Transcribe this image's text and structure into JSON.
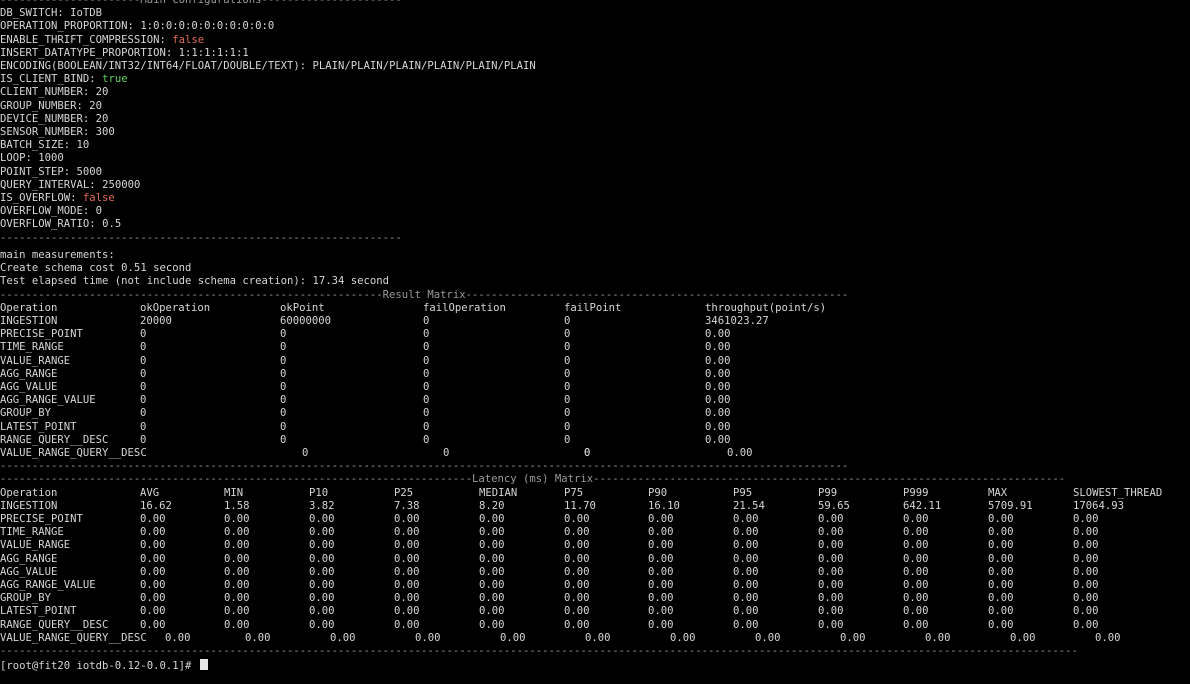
{
  "config": {
    "header": "----------------------Main Configurations----------------------",
    "items": [
      {
        "key": "DB_SWITCH: ",
        "value": "IoTDB",
        "color": "normal"
      },
      {
        "key": "OPERATION_PROPORTION: ",
        "value": "1:0:0:0:0:0:0:0:0:0:0",
        "color": "normal"
      },
      {
        "key": "ENABLE_THRIFT_COMPRESSION: ",
        "value": "false",
        "color": "red"
      },
      {
        "key": "INSERT_DATATYPE_PROPORTION: ",
        "value": "1:1:1:1:1:1",
        "color": "normal"
      },
      {
        "key": "ENCODING(BOOLEAN/INT32/INT64/FLOAT/DOUBLE/TEXT): ",
        "value": "PLAIN/PLAIN/PLAIN/PLAIN/PLAIN/PLAIN",
        "color": "normal"
      },
      {
        "key": "IS_CLIENT_BIND: ",
        "value": "true",
        "color": "green"
      },
      {
        "key": "CLIENT_NUMBER: ",
        "value": "20",
        "color": "normal"
      },
      {
        "key": "GROUP_NUMBER: ",
        "value": "20",
        "color": "normal"
      },
      {
        "key": "DEVICE_NUMBER: ",
        "value": "20",
        "color": "normal"
      },
      {
        "key": "SENSOR_NUMBER: ",
        "value": "300",
        "color": "normal"
      },
      {
        "key": "BATCH_SIZE: ",
        "value": "10",
        "color": "normal"
      },
      {
        "key": "LOOP: ",
        "value": "1000",
        "color": "normal"
      },
      {
        "key": "POINT_STEP: ",
        "value": "5000",
        "color": "normal"
      },
      {
        "key": "QUERY_INTERVAL: ",
        "value": "250000",
        "color": "normal"
      },
      {
        "key": "IS_OVERFLOW: ",
        "value": "false",
        "color": "red"
      },
      {
        "key": "OVERFLOW_MODE: ",
        "value": "0",
        "color": "normal"
      },
      {
        "key": "OVERFLOW_RATIO: ",
        "value": "0.5",
        "color": "normal"
      }
    ],
    "footer": "---------------------------------------------------------------"
  },
  "measurements": {
    "title": "main measurements:",
    "schema": "Create schema cost 0.51 second",
    "elapsed": "Test elapsed time (not include schema creation): 17.34 second"
  },
  "result_matrix": {
    "header": "------------------------------------------------------------Result Matrix------------------------------------------------------------",
    "columns": [
      "Operation",
      "okOperation",
      "okPoint",
      "failOperation",
      "failPoint",
      "throughput(point/s)"
    ],
    "rows": [
      [
        "INGESTION",
        "20000",
        "60000000",
        "0",
        "0",
        "3461023.27"
      ],
      [
        "PRECISE_POINT",
        "0",
        "0",
        "0",
        "0",
        "0.00"
      ],
      [
        "TIME_RANGE",
        "0",
        "0",
        "0",
        "0",
        "0.00"
      ],
      [
        "VALUE_RANGE",
        "0",
        "0",
        "0",
        "0",
        "0.00"
      ],
      [
        "AGG_RANGE",
        "0",
        "0",
        "0",
        "0",
        "0.00"
      ],
      [
        "AGG_VALUE",
        "0",
        "0",
        "0",
        "0",
        "0.00"
      ],
      [
        "AGG_RANGE_VALUE",
        "0",
        "0",
        "0",
        "0",
        "0.00"
      ],
      [
        "GROUP_BY",
        "0",
        "0",
        "0",
        "0",
        "0.00"
      ],
      [
        "LATEST_POINT",
        "0",
        "0",
        "0",
        "0",
        "0.00"
      ],
      [
        "RANGE_QUERY__DESC",
        "0",
        "0",
        "0",
        "0",
        "0.00"
      ]
    ],
    "last_row": [
      "VALUE_RANGE_QUERY__DESC",
      "0",
      "0",
      "0",
      "0",
      "0.00"
    ],
    "footer": "-------------------------------------------------------------------------------------------------------------------------------------"
  },
  "latency_matrix": {
    "header": "--------------------------------------------------------------------------Latency (ms) Matrix--------------------------------------------------------------------------",
    "columns": [
      "Operation",
      "AVG",
      "MIN",
      "P10",
      "P25",
      "MEDIAN",
      "P75",
      "P90",
      "P95",
      "P99",
      "P999",
      "MAX",
      "SLOWEST_THREAD"
    ],
    "rows": [
      [
        "INGESTION",
        "16.62",
        "1.58",
        "3.82",
        "7.38",
        "8.20",
        "11.70",
        "16.10",
        "21.54",
        "59.65",
        "642.11",
        "5709.91",
        "17064.93"
      ],
      [
        "PRECISE_POINT",
        "0.00",
        "0.00",
        "0.00",
        "0.00",
        "0.00",
        "0.00",
        "0.00",
        "0.00",
        "0.00",
        "0.00",
        "0.00",
        "0.00"
      ],
      [
        "TIME_RANGE",
        "0.00",
        "0.00",
        "0.00",
        "0.00",
        "0.00",
        "0.00",
        "0.00",
        "0.00",
        "0.00",
        "0.00",
        "0.00",
        "0.00"
      ],
      [
        "VALUE_RANGE",
        "0.00",
        "0.00",
        "0.00",
        "0.00",
        "0.00",
        "0.00",
        "0.00",
        "0.00",
        "0.00",
        "0.00",
        "0.00",
        "0.00"
      ],
      [
        "AGG_RANGE",
        "0.00",
        "0.00",
        "0.00",
        "0.00",
        "0.00",
        "0.00",
        "0.00",
        "0.00",
        "0.00",
        "0.00",
        "0.00",
        "0.00"
      ],
      [
        "AGG_VALUE",
        "0.00",
        "0.00",
        "0.00",
        "0.00",
        "0.00",
        "0.00",
        "0.00",
        "0.00",
        "0.00",
        "0.00",
        "0.00",
        "0.00"
      ],
      [
        "AGG_RANGE_VALUE",
        "0.00",
        "0.00",
        "0.00",
        "0.00",
        "0.00",
        "0.00",
        "0.00",
        "0.00",
        "0.00",
        "0.00",
        "0.00",
        "0.00"
      ],
      [
        "GROUP_BY",
        "0.00",
        "0.00",
        "0.00",
        "0.00",
        "0.00",
        "0.00",
        "0.00",
        "0.00",
        "0.00",
        "0.00",
        "0.00",
        "0.00"
      ],
      [
        "LATEST_POINT",
        "0.00",
        "0.00",
        "0.00",
        "0.00",
        "0.00",
        "0.00",
        "0.00",
        "0.00",
        "0.00",
        "0.00",
        "0.00",
        "0.00"
      ],
      [
        "RANGE_QUERY__DESC",
        "0.00",
        "0.00",
        "0.00",
        "0.00",
        "0.00",
        "0.00",
        "0.00",
        "0.00",
        "0.00",
        "0.00",
        "0.00",
        "0.00"
      ]
    ],
    "last_row": [
      "VALUE_RANGE_QUERY__DESC",
      "0.00",
      "0.00",
      "0.00",
      "0.00",
      "0.00",
      "0.00",
      "0.00",
      "0.00",
      "0.00",
      "0.00",
      "0.00",
      "0.00"
    ],
    "footer": "-------------------------------------------------------------------------------------------------------------------------------------------------------------------------"
  },
  "prompt": "[root@fit20 iotdb-0.12-0.0.1]# "
}
